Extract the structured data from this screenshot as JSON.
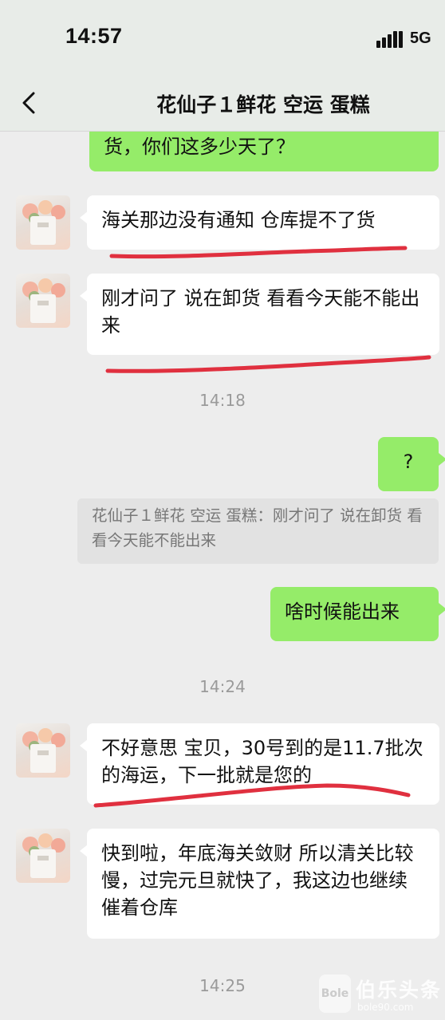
{
  "status_bar": {
    "time": "14:57",
    "network": "5G"
  },
  "header": {
    "back_icon": "chevron-left-icon",
    "title": "花仙子１鲜花 空运 蛋糕"
  },
  "messages": [
    {
      "side": "right",
      "text": "货，你们这多少天了？"
    },
    {
      "side": "left",
      "text": "海关那边没有通知 仓库提不了货"
    },
    {
      "side": "left",
      "text": "刚才问了 说在卸货 看看今天能不能出来"
    },
    {
      "timestamp": "14:18"
    },
    {
      "side": "right",
      "text": "?"
    },
    {
      "quote": "花仙子１鲜花 空运 蛋糕：刚才问了 说在卸货 看看今天能不能出来"
    },
    {
      "side": "right",
      "text": "啥时候能出来"
    },
    {
      "timestamp": "14:24"
    },
    {
      "side": "left",
      "text": "不好意思 宝贝，30号到的是11.7批次的海运，下一批就是您的"
    },
    {
      "side": "left",
      "text": "快到啦，年底海关敛财 所以清关比较慢，过完元旦就快了，我这边也继续催着仓库"
    },
    {
      "timestamp": "14:25"
    }
  ],
  "annotation_color": "#e0303f",
  "watermark": {
    "text": "伯乐头条",
    "sub": "bole90.com",
    "logo": "Bole"
  }
}
